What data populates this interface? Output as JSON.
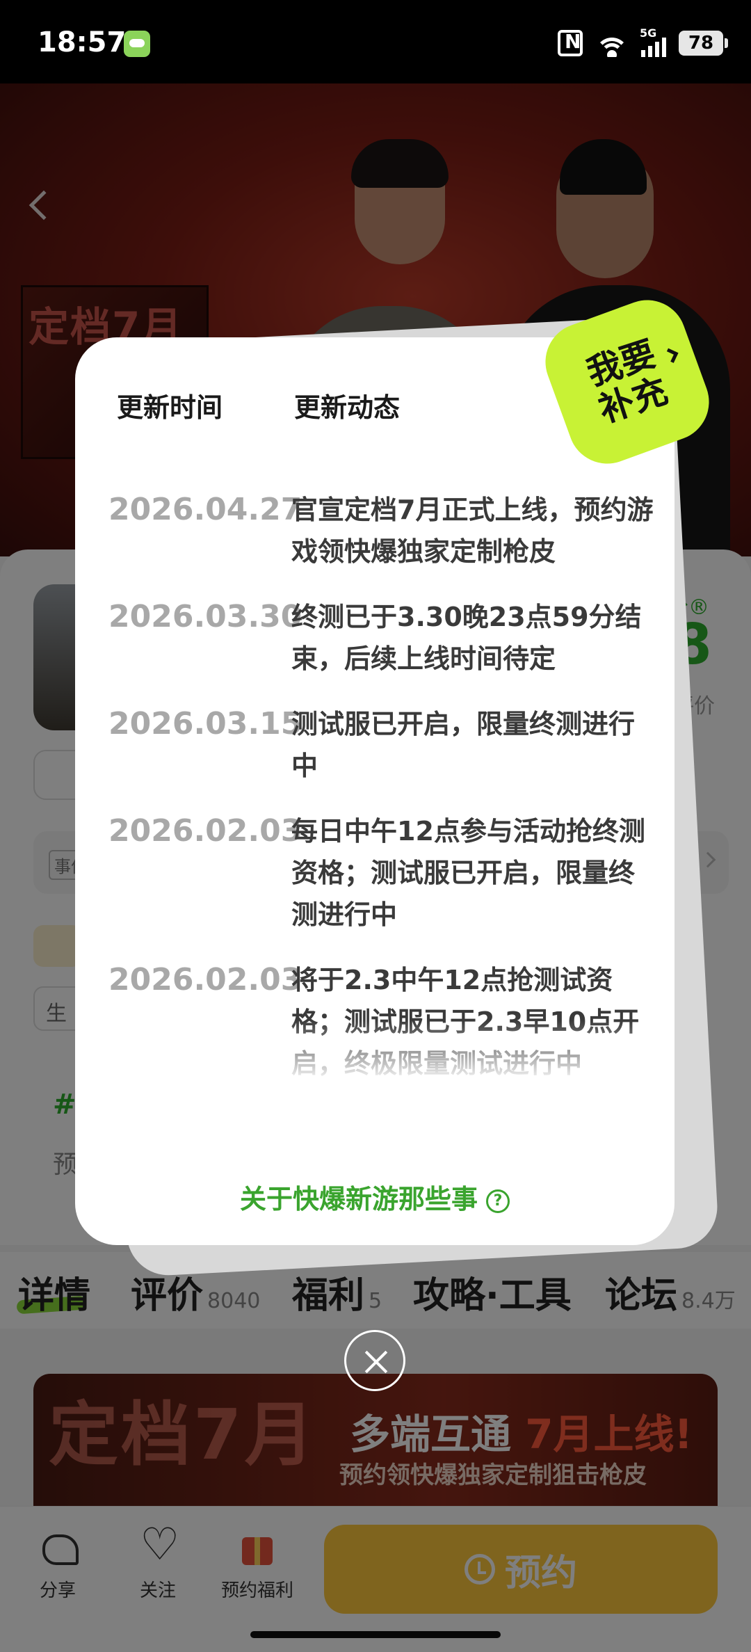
{
  "status_bar": {
    "time": "18:57",
    "network": "5G",
    "battery": "78"
  },
  "hero": {
    "poster_text": "定档7月"
  },
  "detail": {
    "score_label": "分®",
    "score_value": "8",
    "score_sub": "评价",
    "event_tag": "事件",
    "event_more": "..",
    "life_tag": "生活",
    "hash": "#",
    "pre_text": "预"
  },
  "tabs": [
    {
      "label": "详情",
      "count": ""
    },
    {
      "label": "评价",
      "count": "8040"
    },
    {
      "label": "福利",
      "count": "5"
    },
    {
      "label": "攻略·工具",
      "count": ""
    },
    {
      "label": "论坛",
      "count": "8.4万"
    }
  ],
  "banner": {
    "big_text": "定档7月",
    "line1_a": "多端互通 ",
    "line1_b": "7月上线!",
    "line2": "预约领快爆独家定制狙击枪皮"
  },
  "bottom_bar": {
    "share": "分享",
    "follow": "关注",
    "reserve_gift": "预约福利",
    "reserve_button": "预约"
  },
  "modal": {
    "col_time": "更新时间",
    "col_news": "更新动态",
    "badge": "我要\n补充",
    "updates": [
      {
        "date": "2026.04.27",
        "text": "官宣定档7月正式上线，预约游戏领快爆独家定制枪皮"
      },
      {
        "date": "2026.03.30",
        "text": "终测已于3.30晚23点59分结束，后续上线时间待定"
      },
      {
        "date": "2026.03.15",
        "text": "测试服已开启，限量终测进行中"
      },
      {
        "date": "2026.02.03",
        "text": "每日中午12点参与活动抢终测资格；测试服已开启，限量终测进行中"
      },
      {
        "date": "2026.02.03",
        "text": "将于2.3中午12点抢测试资格；测试服已于2.3早10点开启，终极限量测试进行中"
      }
    ],
    "footer_link": "关于快爆新游那些事"
  }
}
